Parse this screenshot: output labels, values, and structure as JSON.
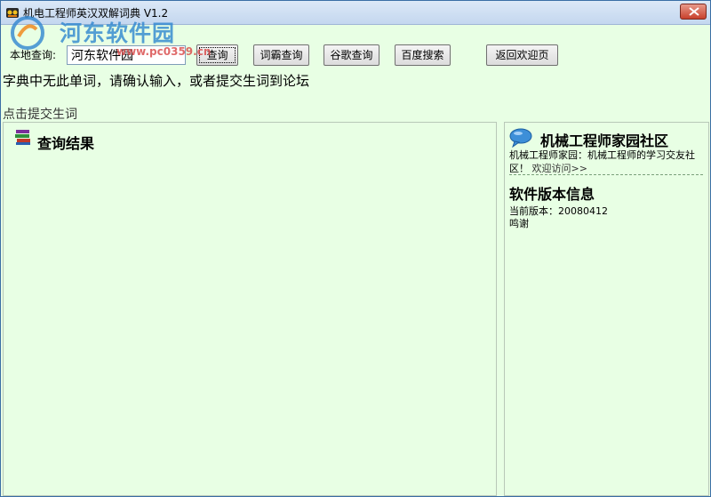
{
  "window": {
    "title": "机电工程师英汉双解词典 V1.2"
  },
  "watermark": {
    "site_name": "河东软件园",
    "url": "www.pc0359.cn"
  },
  "search": {
    "label": "本地查询:",
    "value": "河东软件园"
  },
  "buttons": {
    "query": "查询",
    "iciba": "词霸查询",
    "google": "谷歌查询",
    "baidu": "百度搜索",
    "back_home": "返回欢迎页"
  },
  "message": "字典中无此单词，请确认输入，或者提交生词到论坛",
  "submit_link": "点击提交生词",
  "results": {
    "title": "查询结果"
  },
  "sidebar": {
    "community_title": "机械工程师家园社区",
    "community_desc": "机械工程师家园：机械工程师的学习交友社区！",
    "visit_link": "欢迎访问>>",
    "version_title": "软件版本信息",
    "version_label": "当前版本：",
    "version_value": "20080412",
    "thanks": "鸣谢"
  },
  "colors": {
    "background": "#e8ffe4",
    "title_bar": "#c4d7ef",
    "close_button": "#c8402c"
  }
}
